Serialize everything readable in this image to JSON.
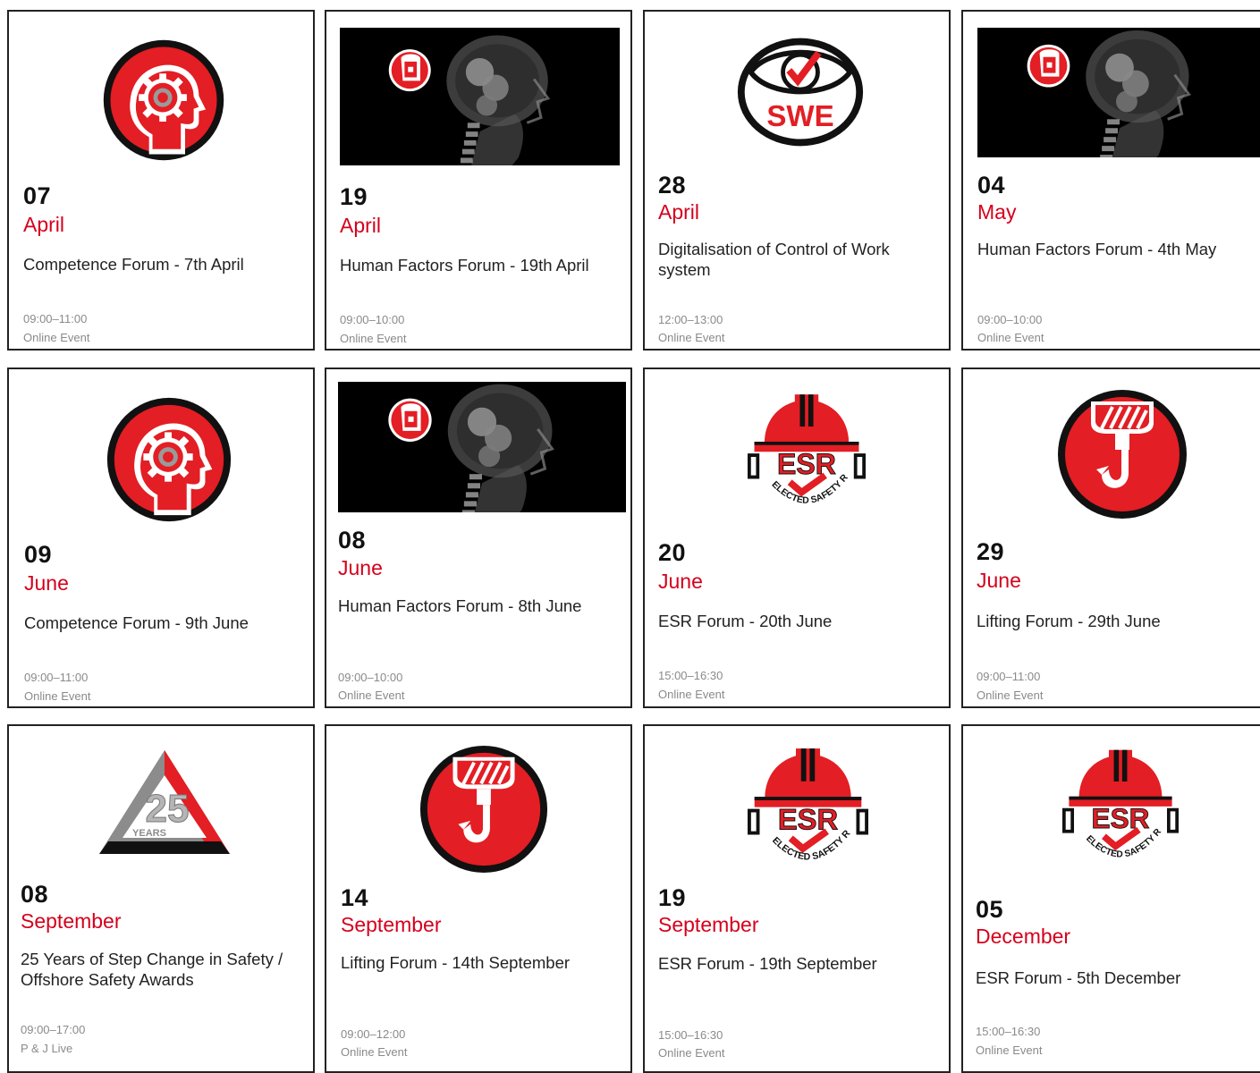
{
  "events": [
    {
      "day": "07",
      "month": "April",
      "title": "Competence Forum - 7th April",
      "time": "09:00–11:00",
      "location": "Online Event",
      "icon": "competence-head-icon"
    },
    {
      "day": "19",
      "month": "April",
      "title": "Human Factors Forum - 19th April",
      "time": "09:00–10:00",
      "location": "Online Event",
      "icon": "human-factors-xray-image"
    },
    {
      "day": "28",
      "month": "April",
      "title": "Digitalisation of Control of Work system",
      "time": "12:00–13:00",
      "location": "Online Event",
      "icon": "swe-eye-icon",
      "icon_text": "SWE"
    },
    {
      "day": "04",
      "month": "May",
      "title": "Human Factors Forum - 4th May",
      "time": "09:00–10:00",
      "location": "Online Event",
      "icon": "human-factors-xray-image"
    },
    {
      "day": "09",
      "month": "June",
      "title": "Competence Forum - 9th June",
      "time": "09:00–11:00",
      "location": "Online Event",
      "icon": "competence-head-icon"
    },
    {
      "day": "08",
      "month": "June",
      "title": "Human Factors Forum - 8th June",
      "time": "09:00–10:00",
      "location": "Online Event",
      "icon": "human-factors-xray-image"
    },
    {
      "day": "20",
      "month": "June",
      "title": "ESR Forum - 20th June",
      "time": "15:00–16:30",
      "location": "Online Event",
      "icon": "esr-helmet-icon",
      "icon_text": "ESR",
      "icon_subtext": "ELECTED SAFETY REP"
    },
    {
      "day": "29",
      "month": "June",
      "title": "Lifting Forum - 29th June",
      "time": "09:00–11:00",
      "location": "Online Event",
      "icon": "lifting-hook-icon"
    },
    {
      "day": "08",
      "month": "September",
      "title": "25 Years of Step Change in Safety / Offshore Safety Awards",
      "time": "09:00–17:00",
      "location": "P & J Live",
      "icon": "25-years-triangle-logo",
      "icon_text": "25",
      "icon_subtext": "YEARS"
    },
    {
      "day": "14",
      "month": "September",
      "title": "Lifting Forum - 14th September",
      "time": "09:00–12:00",
      "location": "Online Event",
      "icon": "lifting-hook-icon"
    },
    {
      "day": "19",
      "month": "September",
      "title": "ESR Forum - 19th September",
      "time": "15:00–16:30",
      "location": "Online Event",
      "icon": "esr-helmet-icon",
      "icon_text": "ESR",
      "icon_subtext": "ELECTED SAFETY REP"
    },
    {
      "day": "05",
      "month": "December",
      "title": "ESR Forum - 5th December",
      "time": "15:00–16:30",
      "location": "Online Event",
      "icon": "esr-helmet-icon",
      "icon_text": "ESR",
      "icon_subtext": "ELECTED SAFETY REP"
    }
  ],
  "colors": {
    "accent": "#d5001c",
    "text": "#222222",
    "muted": "#8a8a8a",
    "border": "#222222"
  }
}
